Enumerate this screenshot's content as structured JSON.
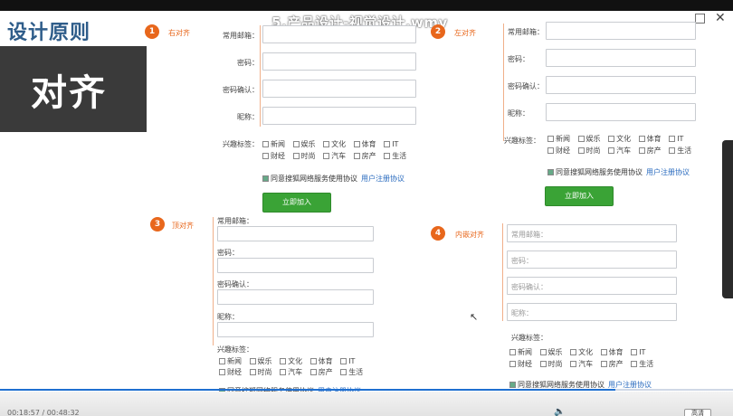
{
  "video": {
    "title": "5.产品设计-视觉设计.wmv",
    "minimize": "_",
    "maximize": "□",
    "close": "✕",
    "time": "00:18:57 / 00:48:32",
    "hd_label": "高清",
    "progress": 0.84
  },
  "slide": {
    "title": "设计原则",
    "banner": "对齐"
  },
  "sections": [
    {
      "num": "1",
      "label": "右对齐"
    },
    {
      "num": "2",
      "label": "左对齐"
    },
    {
      "num": "3",
      "label": "顶对齐"
    },
    {
      "num": "4",
      "label": "内嵌对齐"
    }
  ],
  "form": {
    "email": "常用邮箱：",
    "password": "密码：",
    "confirm": "密码确认：",
    "nickname": "昵称：",
    "interests": "兴趣标签：",
    "tags_row1": [
      "新闻",
      "娱乐",
      "文化",
      "体育",
      "IT"
    ],
    "tags_row2": [
      "财经",
      "时尚",
      "汽车",
      "房产",
      "生活"
    ],
    "agree": "同意搜狐网络服务使用协议",
    "agree_link": "用户注册协议",
    "submit": "立即加入"
  }
}
